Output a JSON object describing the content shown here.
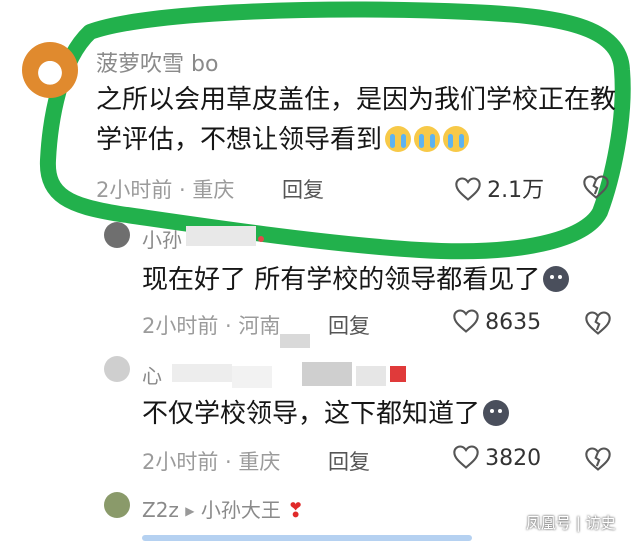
{
  "comments": [
    {
      "username": "菠萝吹雪 bo",
      "text": "之所以会用草皮盖住，是因为我们学校正在教学评估，不想让领导看到",
      "emoji": [
        "loudly-crying-face",
        "loudly-crying-face",
        "loudly-crying-face"
      ],
      "time": "2小时前",
      "location": "重庆",
      "reply_label": "回复",
      "likes": "2.1万"
    },
    {
      "username": "小孙",
      "text": "现在好了 所有学校的领导都看见了",
      "emoji": [
        "dark-face"
      ],
      "time": "2小时前",
      "location": "河南",
      "reply_label": "回复",
      "likes": "8635"
    },
    {
      "username": "心",
      "text": "不仅学校领导，这下都知道了",
      "emoji": [
        "dark-face"
      ],
      "time": "2小时前",
      "location": "重庆",
      "reply_label": "回复",
      "likes": "3820"
    },
    {
      "username": "Z2z",
      "reply_to": "小孙大王",
      "text": "",
      "emoji": [
        "red-heart"
      ]
    }
  ],
  "watermark": "凤凰号 | 访史",
  "colors": {
    "highlight_stroke": "#22b14c"
  }
}
